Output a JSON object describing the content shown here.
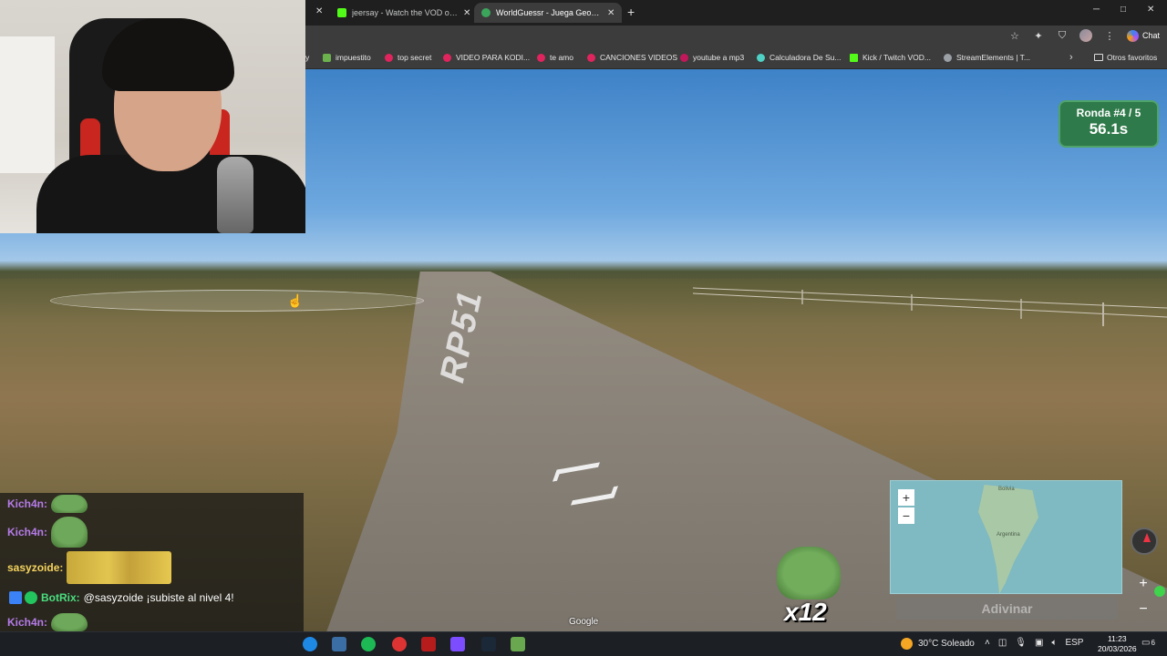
{
  "browser": {
    "tabs": [
      {
        "label": "jeersay - Watch the VOD on Kick",
        "icon_color": "#53fc18"
      },
      {
        "label": "WorldGuessr - Juega GeoGuessr gratis",
        "icon_color": "#3ba55c"
      }
    ],
    "new_tab": "+",
    "window_controls": {
      "minimize": "─",
      "maximize": "□",
      "close": "✕"
    },
    "chat_button_label": "Chat",
    "bookmarks": [
      {
        "label": "y",
        "color": "#9aa0a6"
      },
      {
        "label": "impuestito",
        "color": "#6bb24d"
      },
      {
        "label": "top secret",
        "color": "#e0245e"
      },
      {
        "label": "VIDEO PARA KODI...",
        "color": "#e0245e"
      },
      {
        "label": "te amo",
        "color": "#e0245e"
      },
      {
        "label": "CANCIONES VIDEOS",
        "color": "#e0245e"
      },
      {
        "label": "youtube a mp3",
        "color": "#c2185b"
      },
      {
        "label": "Calculadora De Su...",
        "color": "#4fd1c5"
      },
      {
        "label": "Kick / Twitch VOD...",
        "color": "#53fc18"
      },
      {
        "label": "StreamElements | T...",
        "color": "#9aa0a6"
      }
    ],
    "bookmarks_more": "›",
    "other_bookmarks": "Otros favoritos"
  },
  "game": {
    "round_title": "Ronda #4 / 5",
    "round_timer": "56.1s",
    "road_sign": "RP51",
    "google_attribution": "Google",
    "guess_button": "Adivinar",
    "map_zoom_in": "+",
    "map_zoom_out": "−",
    "sv_zoom_in": "+",
    "sv_zoom_out": "−",
    "map_labels": [
      "Bolivia",
      "Argentina"
    ]
  },
  "chat": {
    "messages": [
      {
        "user": "Kich4n:",
        "user_color": "#b57be8",
        "text": ""
      },
      {
        "user": "Kich4n:",
        "user_color": "#b57be8",
        "text": ""
      },
      {
        "user": "sasyzoide:",
        "user_color": "#f4d35e",
        "text": ""
      },
      {
        "user": "BotRix:",
        "user_color": "#4ade80",
        "text": "@sasyzoide ¡subiste al nivel 4!"
      },
      {
        "user": "Kich4n:",
        "user_color": "#b57be8",
        "text": ""
      }
    ],
    "emote_overlay_count": "x12"
  },
  "taskbar": {
    "weather": "30°C  Soleado",
    "language": "ESP",
    "time": "11:23",
    "date": "20/03/2026",
    "notifications": "6"
  }
}
